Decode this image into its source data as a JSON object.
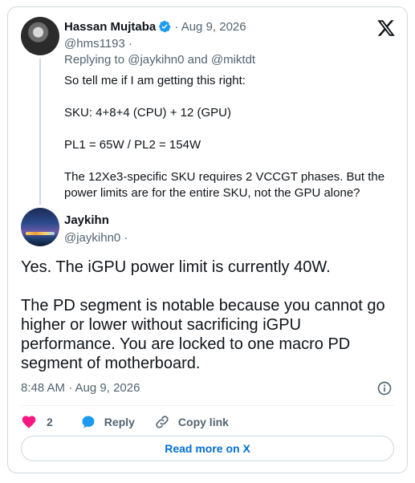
{
  "colors": {
    "accent": "#1d9bf0",
    "like": "#f91880",
    "link": "#006fd6",
    "muted": "#536471"
  },
  "parent_tweet": {
    "name": "Hassan Mujtaba",
    "separator_date": "· Aug 9, 2026",
    "handle": "@hms1193 ·",
    "replying_prefix": "Replying to ",
    "replying_user1": "@jaykihn0",
    "replying_and": " and ",
    "replying_user2": "@miktdt",
    "body": [
      "So tell me if I am getting this right:",
      "SKU: 4+8+4 (CPU) + 12 (GPU)",
      "PL1 = 65W / PL2 = 154W",
      "The 12Xe3-specific SKU requires 2 VCCGT phases. But the power limits are for the entire SKU, not the GPU alone?"
    ]
  },
  "main_tweet": {
    "name": "Jaykihn",
    "handle": "@jaykihn0 ·",
    "body": [
      "Yes. The iGPU power limit is currently 40W.",
      "The PD segment is notable because you cannot go higher or lower without sacrificing iGPU performance. You are locked to one macro PD segment of motherboard."
    ],
    "timestamp": "8:48 AM · Aug 9, 2026"
  },
  "actions": {
    "like_count": "2",
    "reply_label": "Reply",
    "copy_link_label": "Copy link"
  },
  "read_more_label": "Read more on X",
  "icons": [
    "x-logo-icon",
    "verified-badge-icon",
    "info-icon",
    "heart-icon",
    "reply-icon",
    "link-icon"
  ]
}
